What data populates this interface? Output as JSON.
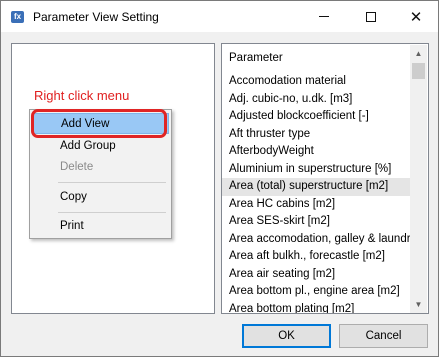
{
  "window": {
    "title": "Parameter View Setting",
    "icon": "app-icon",
    "icon_glyph": "fx",
    "controls": {
      "minimize": "minimize-icon",
      "maximize": "maximize-icon",
      "close": "close-icon",
      "close_glyph": "✕"
    }
  },
  "annotation": {
    "text": "Right click menu",
    "color": "#e02020"
  },
  "context_menu": {
    "items": [
      {
        "label": "Add View",
        "state": "highlighted"
      },
      {
        "label": "Add Group",
        "state": "enabled"
      },
      {
        "label": "Delete",
        "state": "disabled"
      },
      {
        "label": "Copy",
        "state": "enabled"
      },
      {
        "label": "Print",
        "state": "enabled"
      }
    ]
  },
  "parameter_list": {
    "header": "Parameter",
    "items": [
      "Accomodation material",
      "Adj. cubic-no, u.dk. [m3]",
      "Adjusted blockcoefficient [-]",
      "Aft thruster type",
      "AfterbodyWeight",
      "Aluminium in superstructure [%]",
      "Area (total) superstructure [m2]",
      "Area HC cabins [m2]",
      "Area SES-skirt [m2]",
      "Area accomodation, galley & laundry [",
      "Area aft bulkh., forecastle [m2]",
      "Area air seating [m2]",
      "Area bottom pl., engine area [m2]",
      "Area bottom plating [m2]"
    ],
    "selected_index": 6
  },
  "buttons": {
    "ok": "OK",
    "cancel": "Cancel"
  },
  "colors": {
    "highlight": "#99c8f5",
    "annotation_red": "#e02020",
    "selected_row": "#e5e5e5"
  }
}
